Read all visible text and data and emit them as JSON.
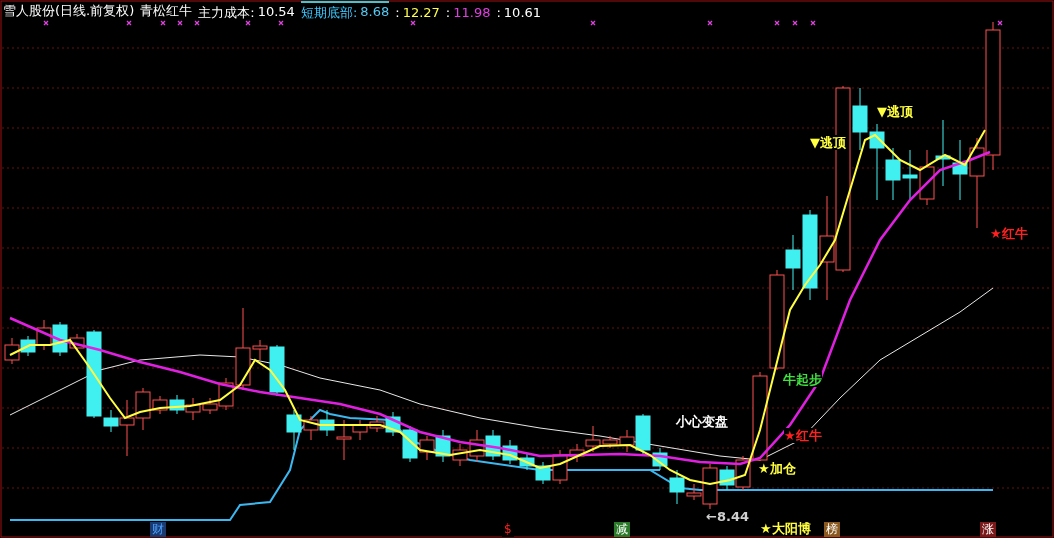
{
  "header": {
    "stock_title": "雪人股份(日线.前复权)",
    "indicator_name": "青松红牛",
    "items": [
      {
        "label": "主力成本:",
        "value": "10.54",
        "color": "#ffffff",
        "selected": false
      },
      {
        "label": "短期底部:",
        "value": "8.68",
        "color": "#56c8f0",
        "selected": true
      },
      {
        "label": ":",
        "value": "12.27",
        "color": "#ffff4a",
        "selected": false
      },
      {
        "label": ":",
        "value": "11.98",
        "color": "#e040e0",
        "selected": false
      },
      {
        "label": ":",
        "value": "10.61",
        "color": "#ffffff",
        "selected": false
      }
    ]
  },
  "annotations": [
    {
      "text": "▼逃顶",
      "color": "#ffff40"
    },
    {
      "text": "▼逃顶",
      "color": "#ffff40"
    },
    {
      "text": "小心变盘",
      "color": "#ffffff"
    },
    {
      "text": "牛起步",
      "color": "#40e040"
    },
    {
      "text": "★红牛",
      "color": "#ff2020"
    },
    {
      "text": "★加仓",
      "color": "#ffff40"
    },
    {
      "text": "←8.44",
      "color": "#d0d0d0"
    },
    {
      "text": "★红牛",
      "color": "#ff2020"
    },
    {
      "text": "★大阳博",
      "color": "#ffff40"
    }
  ],
  "markers": [
    {
      "text": "财",
      "color": "#1a3a70"
    },
    {
      "text": "$",
      "color": "#000000"
    },
    {
      "text": "减",
      "color": "#2a7a2a"
    },
    {
      "text": "榜",
      "color": "#8a5a20"
    },
    {
      "text": "涨",
      "color": "#7a1a1a"
    }
  ]
}
